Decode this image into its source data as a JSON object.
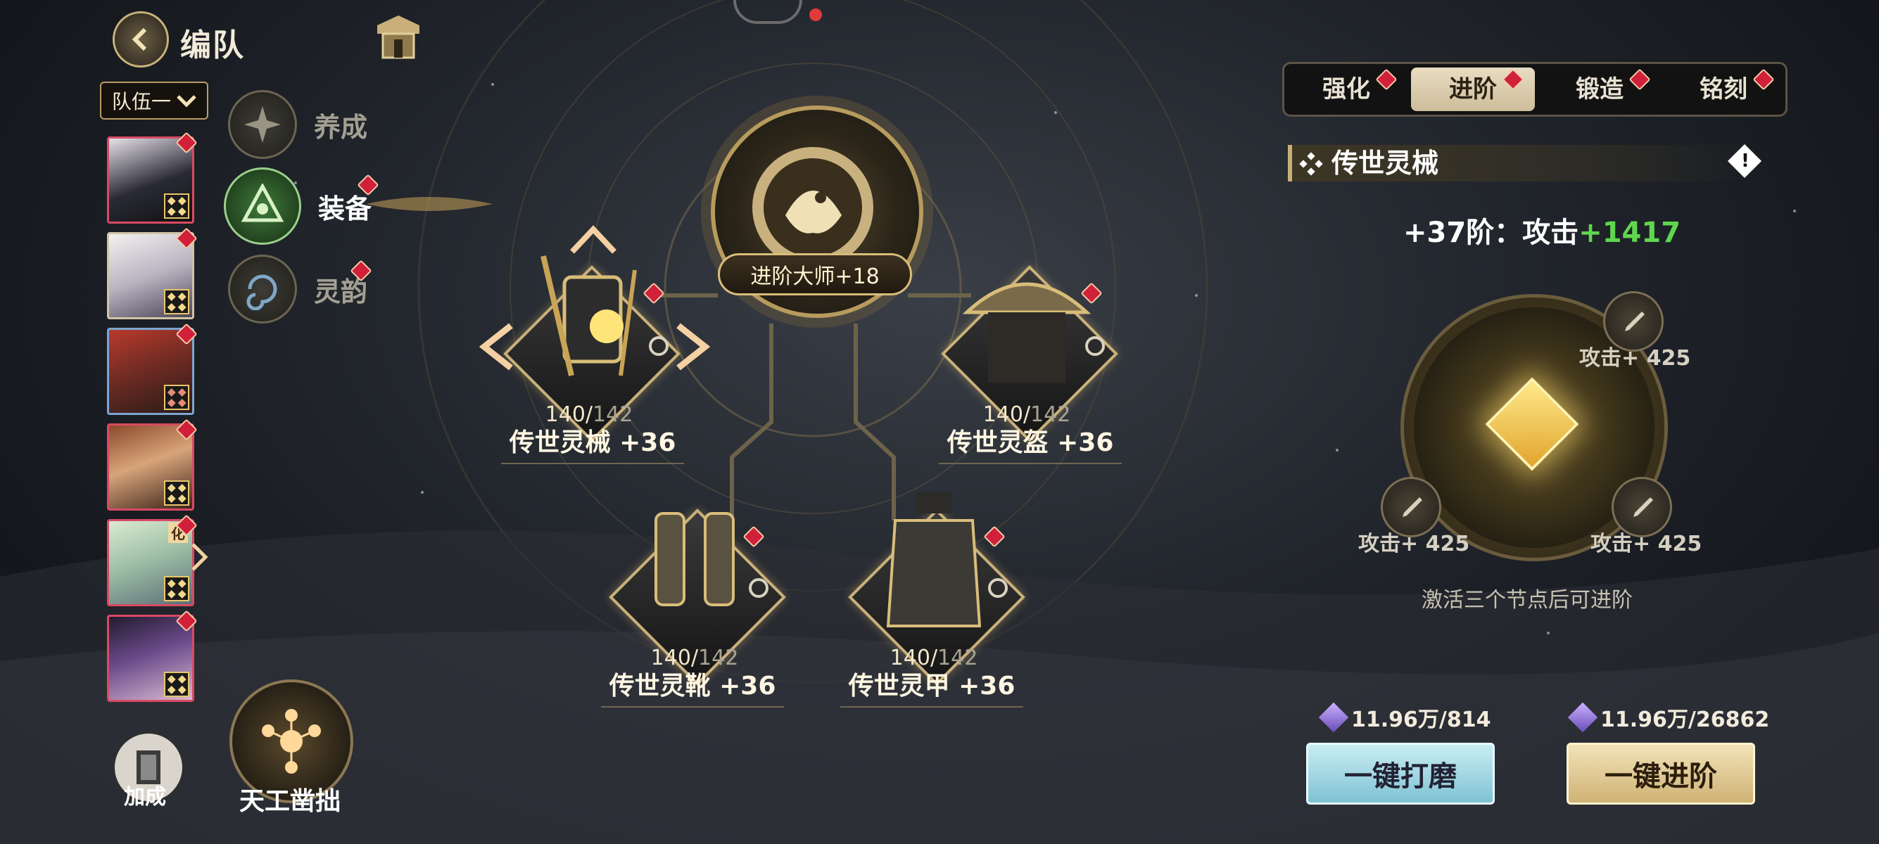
{
  "header": {
    "title": "编队"
  },
  "team_selector": {
    "label": "队伍一"
  },
  "side_menu": [
    {
      "label": "养成"
    },
    {
      "label": "装备"
    },
    {
      "label": "灵韵"
    }
  ],
  "portraits": [
    {
      "tag": ""
    },
    {
      "tag": ""
    },
    {
      "tag": ""
    },
    {
      "tag": ""
    },
    {
      "tag": "化"
    },
    {
      "tag": ""
    }
  ],
  "bottom_left": {
    "bonus_label": "加成",
    "craft_label": "天工凿拙"
  },
  "center": {
    "master_label": "进阶大师+18"
  },
  "equipment": [
    {
      "name": "传世灵械 +36",
      "level": "140",
      "max": "142"
    },
    {
      "name": "传世灵盔 +36",
      "level": "140",
      "max": "142"
    },
    {
      "name": "传世灵靴 +36",
      "level": "140",
      "max": "142"
    },
    {
      "name": "传世灵甲 +36",
      "level": "140",
      "max": "142"
    }
  ],
  "tabs": [
    {
      "label": "强化"
    },
    {
      "label": "进阶"
    },
    {
      "label": "锻造"
    },
    {
      "label": "铭刻"
    }
  ],
  "active_tab": "进阶",
  "panel": {
    "title": "传世灵械",
    "stage_prefix": "+37阶：攻击",
    "stage_bonus": "+1417",
    "nodes": [
      {
        "label": "攻击+ 425"
      },
      {
        "label": "攻击+ 425"
      },
      {
        "label": "攻击+ 425"
      }
    ],
    "hint": "激活三个节点后可进阶"
  },
  "costs": [
    {
      "text": "11.96万/814"
    },
    {
      "text": "11.96万/26862"
    }
  ],
  "buttons": {
    "polish": "一键打磨",
    "advance": "一键进阶"
  },
  "colors": {
    "accent_gold": "#c9b07a",
    "bonus_green": "#5fd64e",
    "alert_red": "#d0203a"
  }
}
